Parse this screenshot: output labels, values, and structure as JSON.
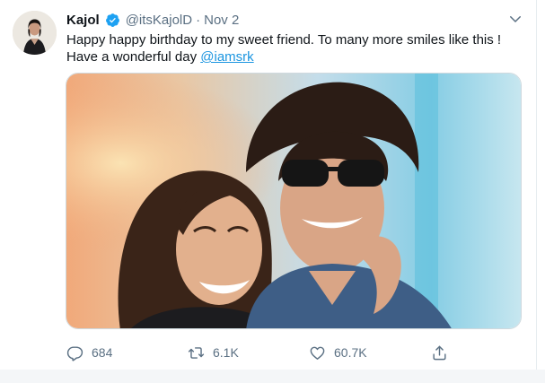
{
  "tweet": {
    "author": {
      "name": "Kajol",
      "handle": "@itsKajolD",
      "separator": "·",
      "date": "Nov 2",
      "verified": true,
      "avatar_icon": "profile-photo"
    },
    "text_main": "Happy happy birthday to my sweet friend. To many more smiles like this ! Have a wonderful day ",
    "mention": "@iamsrk",
    "media_icon": "photo-two-people-smiling"
  },
  "actions": {
    "replies": "684",
    "retweets": "6.1K",
    "likes": "60.7K"
  },
  "colors": {
    "accent": "#1b95e0",
    "verified": "#1da1f2",
    "secondary_text": "#5b7083"
  }
}
